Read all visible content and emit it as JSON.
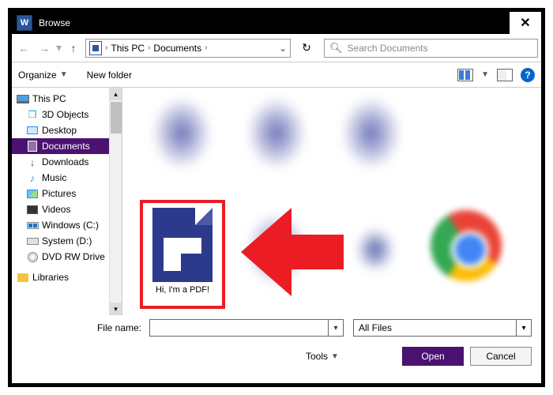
{
  "title": "Browse",
  "nav": {
    "active": "This PC",
    "folder": "Documents"
  },
  "search": {
    "placeholder": "Search Documents"
  },
  "toolbar": {
    "organize": "Organize",
    "newfolder": "New folder"
  },
  "sidebar": {
    "items": [
      {
        "label": "This PC"
      },
      {
        "label": "3D Objects"
      },
      {
        "label": "Desktop"
      },
      {
        "label": "Documents"
      },
      {
        "label": "Downloads"
      },
      {
        "label": "Music"
      },
      {
        "label": "Pictures"
      },
      {
        "label": "Videos"
      },
      {
        "label": "Windows (C:)"
      },
      {
        "label": "System (D:)"
      },
      {
        "label": "DVD RW Drive"
      },
      {
        "label": "Libraries"
      }
    ]
  },
  "content": {
    "highlighted_file": "Hi, I'm a PDF!"
  },
  "footer": {
    "filename_label": "File name:",
    "filter": "All Files",
    "tools": "Tools",
    "open": "Open",
    "cancel": "Cancel"
  }
}
